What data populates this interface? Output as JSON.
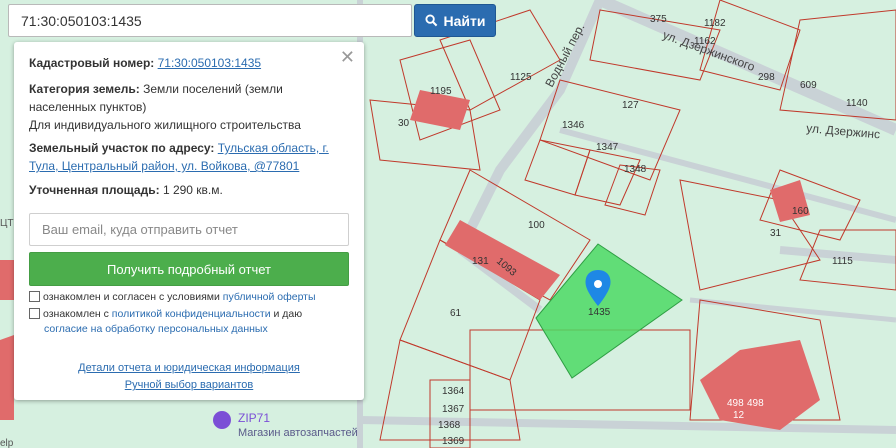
{
  "search": {
    "value": "71:30:050103:1435",
    "button_label": "Найти"
  },
  "panel": {
    "cadastral_label": "Кадастровый номер:",
    "cadastral_value": "71:30:050103:1435",
    "category_label": "Категория земель:",
    "category_value_1": "Земли поселений (земли",
    "category_value_2": "населенных пунктов)",
    "category_value_3": "Для индивидуального жилищного строительства",
    "address_label": "Земельный участок по адресу:",
    "address_value_1": "Тульская область, г.",
    "address_value_2": "Тула, Центральный район, ул. Войкова, @77801",
    "area_label": "Уточненная площадь:",
    "area_value": "1 290 кв.м.",
    "email_placeholder": "Ваш email, куда отправить отчет",
    "report_button": "Получить подробный отчет",
    "consent1_text": "ознакомлен и согласен с условиями ",
    "consent1_link": "публичной оферты",
    "consent2_text": "ознакомлен с ",
    "consent2_link1": "политикой конфиденциальности",
    "consent2_mid": " и даю",
    "consent2_link2": "согласие на обработку персональных данных",
    "details_link": "Детали отчета и юридическая информация",
    "manual_link": "Ручной выбор вариантов"
  },
  "map": {
    "streets": [
      "ул. Дзержинского",
      "ул. Дзержинс",
      "Водный пер."
    ],
    "parcels": [
      "375",
      "1182",
      "1162",
      "298",
      "609",
      "1140",
      "1125",
      "1195",
      "30",
      "127",
      "1346",
      "1347",
      "1348",
      "100",
      "160",
      "31",
      "1115",
      "131",
      "1093",
      "1435",
      "61",
      "1364",
      "1367",
      "1369",
      "1368",
      "498",
      "498",
      "12"
    ],
    "poi_name": "ZIP71",
    "poi_desc": "Магазин автозапчастей",
    "partial_labels": [
      "ЦТ",
      "elp"
    ]
  },
  "colors": {
    "map_bg": "#d6f0e0",
    "parcel_stroke": "#c0392b",
    "selected_parcel": "#4cd964",
    "building": "#e06b6b",
    "button_blue": "#2b6cb0",
    "button_green": "#4cae4c"
  }
}
